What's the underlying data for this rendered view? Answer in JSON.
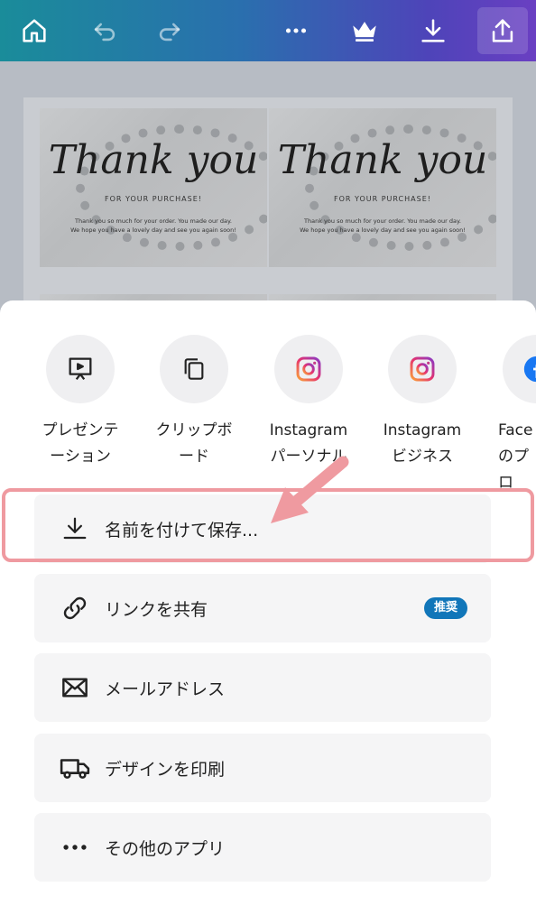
{
  "toolbar": {
    "icons": [
      "home-icon",
      "undo-icon",
      "redo-icon",
      "more-icon",
      "crown-icon",
      "download-icon",
      "share-icon"
    ]
  },
  "design": {
    "title": "Thank you",
    "subtitle": "FOR YOUR PURCHASE!",
    "message_line1": "Thank you so much for your order. You made our day.",
    "message_line2": "We hope you have a lovely day and see you again soon!"
  },
  "share_targets": [
    {
      "label_line1": "プレゼンテ",
      "label_line2": "ーション",
      "icon": "presentation-icon"
    },
    {
      "label_line1": "クリップボ",
      "label_line2": "ード",
      "icon": "clipboard-icon"
    },
    {
      "label_line1": "Instagram",
      "label_line2": "パーソナル",
      "icon": "instagram-icon"
    },
    {
      "label_line1": "Instagram",
      "label_line2": "ビジネス",
      "icon": "instagram-icon"
    },
    {
      "label_line1": "Face",
      "label_line2": "のプロ",
      "icon": "facebook-icon"
    }
  ],
  "actions": {
    "save": {
      "label": "名前を付けて保存..."
    },
    "share_link": {
      "label": "リンクを共有",
      "badge": "推奨"
    },
    "email": {
      "label": "メールアドレス"
    },
    "print": {
      "label": "デザインを印刷"
    },
    "more_apps": {
      "label": "その他のアプリ"
    }
  },
  "colors": {
    "highlight": "#ef9aa0",
    "badge": "#1176b9",
    "toolbar_start": "#1a8c9a",
    "toolbar_end": "#6a3fc2"
  }
}
